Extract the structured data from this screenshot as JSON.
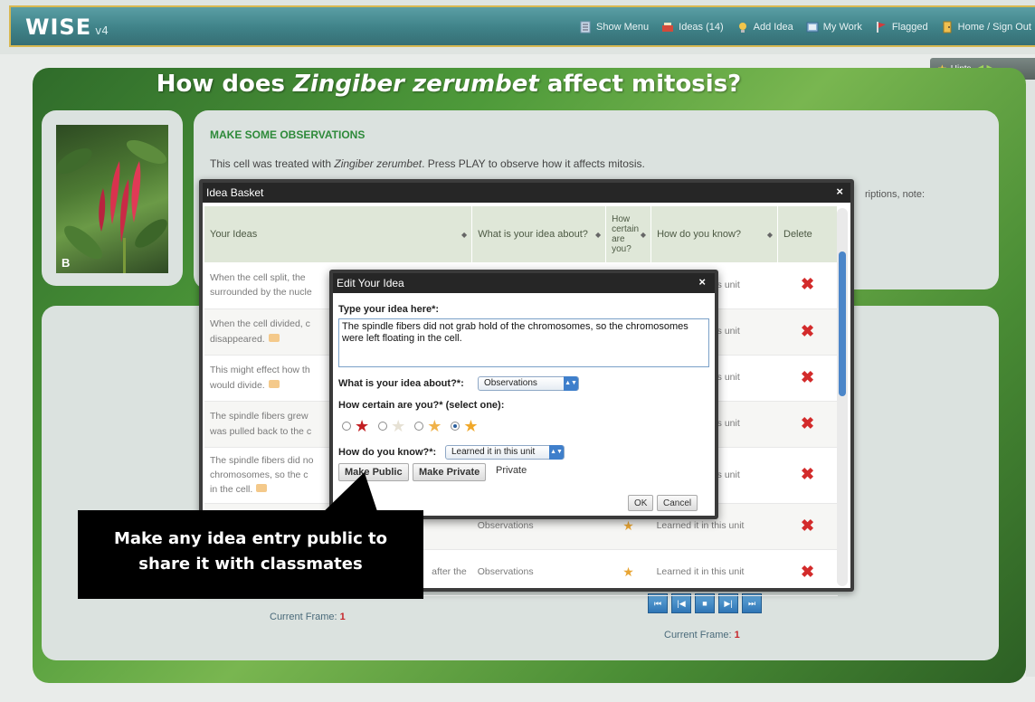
{
  "app": {
    "logo": "WISE",
    "version": "v4"
  },
  "nav": [
    {
      "label": "Show Menu",
      "icon": "menu-icon",
      "color": "#c8d8e8"
    },
    {
      "label": "Ideas (14)",
      "icon": "ideas-basket-icon",
      "color": "#d34a3a"
    },
    {
      "label": "Add Idea",
      "icon": "lightbulb-icon",
      "color": "#f2c64a"
    },
    {
      "label": "My Work",
      "icon": "my-work-icon",
      "color": "#8fb5d6"
    },
    {
      "label": "Flagged",
      "icon": "flag-icon",
      "color": "#d33a3a"
    },
    {
      "label": "Home / Sign Out",
      "icon": "home-icon",
      "color": "#f0c050"
    }
  ],
  "hints": {
    "label": "Hints"
  },
  "page": {
    "title_prefix": "How does ",
    "title_italic": "Zingiber zerumbet",
    "title_suffix": " affect mitosis?",
    "photo_label": "B"
  },
  "observations": {
    "heading": "MAKE SOME OBSERVATIONS",
    "text_prefix": "This cell was treated with ",
    "text_italic": "Zingiber zerumbet",
    "text_suffix": ". Press PLAY to observe how it affects mitosis.",
    "right_fragment": "riptions, note:"
  },
  "player": {
    "frame_label": "Current Frame:",
    "frame_value": "1",
    "controls": [
      "⏮",
      "|◀",
      "■",
      "▶|",
      "⏭"
    ]
  },
  "basket": {
    "title": "Idea Basket",
    "close": "×",
    "columns": {
      "ideas": "Your Ideas",
      "about": "What is your idea about?",
      "certain": "How certain are you?",
      "know": "How do you know?",
      "delete": "Delete"
    },
    "rows": [
      {
        "idea": "When the cell split, the",
        "idea2": "surrounded by the nucle",
        "about": "",
        "know": "this unit"
      },
      {
        "idea": "When the cell divided, c",
        "idea2": "disappeared.",
        "about": "",
        "know": "this unit"
      },
      {
        "idea": "This might effect how th",
        "idea2": "would divide.",
        "about": "",
        "know": "this unit"
      },
      {
        "idea": "The spindle fibers grew",
        "idea2": "was pulled back to the c",
        "about": "",
        "know": "this unit"
      },
      {
        "idea": "The spindle fibers did no",
        "idea2": "chromosomes, so the c",
        "idea3": "in the cell.",
        "about": "",
        "know": "this unit"
      },
      {
        "idea": "",
        "idea2": "",
        "about": "Observations",
        "know": "Learned it in this unit"
      },
      {
        "idea": "after the",
        "idea2": "",
        "about": "Observations",
        "know": "Learned it in this unit"
      }
    ],
    "delete_icon": "✖"
  },
  "edit": {
    "title": "Edit Your Idea",
    "close": "×",
    "idea_label": "Type your idea here*:",
    "idea_value": "The spindle fibers did not grab hold of the chromosomes, so the chromosomes were left floating in the cell.",
    "about_label": "What is your idea about?*:",
    "about_value": "Observations",
    "certain_label": "How certain are you?* (select one):",
    "certain_selected": 3,
    "know_label": "How do you know?*:",
    "know_value": "Learned it in this unit",
    "make_public": "Make Public",
    "make_private": "Make Private",
    "privacy_status": "Private",
    "ok": "OK",
    "cancel": "Cancel"
  },
  "callout": {
    "line1": "Make any idea entry public to",
    "line2": "share it with classmates"
  }
}
